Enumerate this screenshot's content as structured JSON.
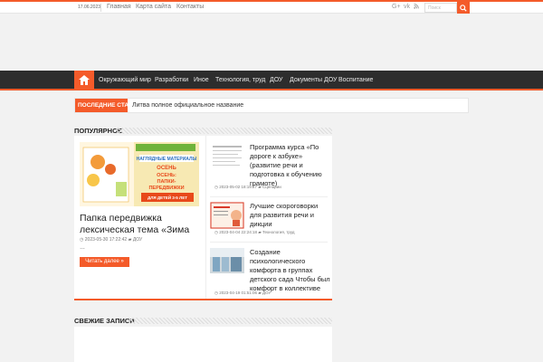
{
  "topbar": {
    "date": "17.06.2023",
    "nav": [
      "Главная",
      "Карта сайта",
      "Контакты"
    ],
    "search_placeholder": "Поиск"
  },
  "icons": {
    "social": [
      "google-plus-icon",
      "vk-icon",
      "rss-icon"
    ],
    "search": "search-icon",
    "home": "home-icon"
  },
  "colors": {
    "accent": "#f45b2a",
    "nav_bg": "#2d2d2d"
  },
  "mainnav": {
    "items": [
      "Окружающий мир",
      "Разработки",
      "Иное",
      "Технология, труд",
      "ДОУ",
      "Документы ДОУ",
      "Воспитание"
    ]
  },
  "breaking": {
    "label": "ПОСЛЕДНИЕ СТАТЬИ",
    "text": "Литва полное официальное название"
  },
  "popular": {
    "title": "ПОПУЛЯРНОЕ",
    "featured": {
      "title": "Папка передвижка лексическая тема «Зима",
      "date": "2023-05-30 17:22:42",
      "category": "ДОУ",
      "ellipsis": "…",
      "read_more": "Читать далее »",
      "image_text": {
        "top": "НАГЛЯДНЫЕ МАТЕРИАЛЫ",
        "season": "ОСЕНЬ",
        "line1": "ОСЕНЬ:",
        "line2": "ПАПКИ-",
        "line3": "ПЕРЕДВИЖКИ",
        "age": "ДЛЯ ДЕТЕЙ 3-5 ЛЕТ"
      }
    },
    "items": [
      {
        "title": "Программа курса «По дороге к азбуке» (развитие речи и подготовка к обучению грамоте)",
        "date": "2023-05-02 18:19:27",
        "category": "Сценарии"
      },
      {
        "title": "Лучшие скороговорки для развития речи и дикции",
        "date": "2023-04-04 22:24:18",
        "category": "Технология, труд"
      },
      {
        "title": "Создание психологического комфорта в группах детского сада Чтобы был комфорт в коллективе",
        "date": "2023-04-19 01:51:06",
        "category": "ДОУ"
      }
    ]
  },
  "fresh": {
    "title": "СВЕЖИЕ ЗАПИСИ"
  }
}
